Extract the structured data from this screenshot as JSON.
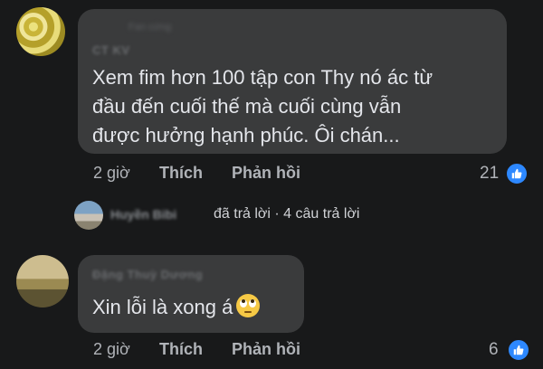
{
  "comments": [
    {
      "author": "CT KV",
      "author_sub": "Fan cứng",
      "text": "Xem fim hơn 100 tập con Thy nó ác từ\nđầu đến cuối thế mà cuối cùng vẫn\nđược hưởng hạnh phúc. Ôi chán...",
      "time": "2 giờ",
      "like_label": "Thích",
      "reply_label": "Phản hồi",
      "reactions": "21",
      "reaction_icon": "like-icon"
    },
    {
      "author": "Đặng Thuỳ Dương",
      "text": "Xin lỗi là xong á",
      "emoji": "face-with-rolling-eyes",
      "time": "2 giờ",
      "like_label": "Thích",
      "reply_label": "Phản hồi",
      "reactions": "6",
      "reaction_icon": "like-icon"
    }
  ],
  "replies_summary": {
    "replier": "Huyền Bibi",
    "text": "đã trả lời · 4 câu trả lời"
  },
  "colors": {
    "background": "#18191a",
    "bubble": "#3a3b3c",
    "text": "#e4e6eb",
    "secondary_text": "#b0b3b8",
    "like_blue": "#2d88ff"
  }
}
